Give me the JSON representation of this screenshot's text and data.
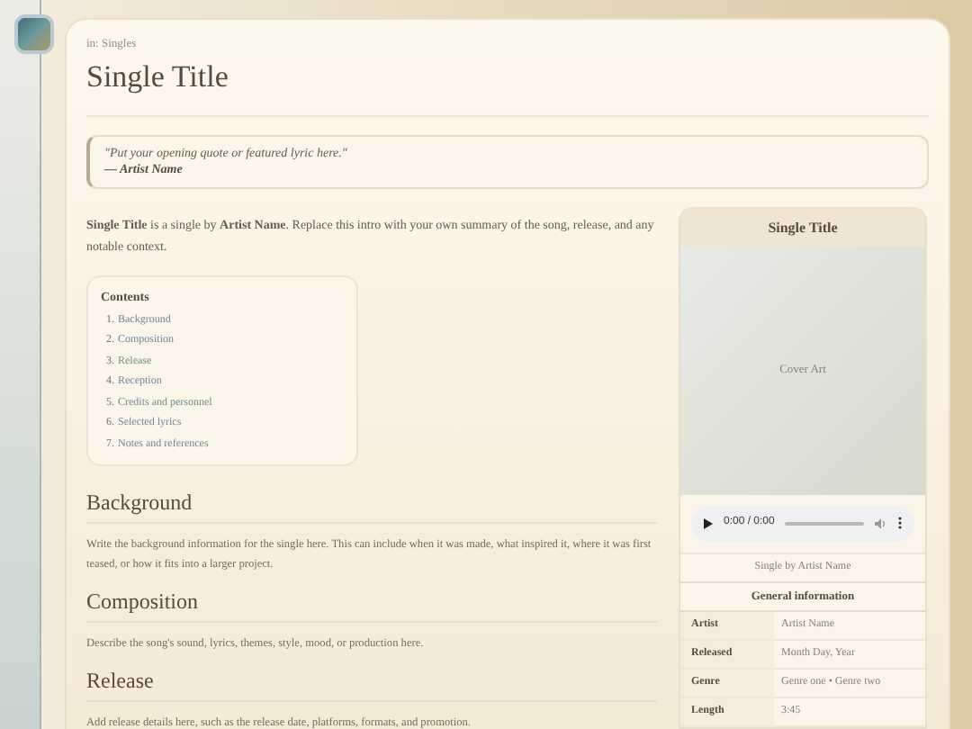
{
  "breadcrumb": "in: Singles",
  "title": "Single Title",
  "quote": {
    "text": "\"Put your opening quote or featured lyric here.\"",
    "attribution": "— Artist Name"
  },
  "intro": "**Single Title** is a single by **Artist Name**. Replace this intro with your own summary of the song, release, and any notable context.",
  "contents": {
    "heading": "Contents",
    "items": [
      {
        "number": "1.",
        "label": "Background"
      },
      {
        "number": "2.",
        "label": "Composition"
      },
      {
        "number": "3.",
        "label": "Release"
      },
      {
        "number": "4.",
        "label": "Reception"
      },
      {
        "number": "5.",
        "label": "Credits and personnel"
      },
      {
        "number": "6.",
        "label": "Selected lyrics"
      },
      {
        "number": "7.",
        "label": "Notes and references"
      }
    ]
  },
  "sections": [
    {
      "heading": "Background",
      "body": "Write the background information for the single here. This can include when it was made, what inspired it, where it was first teased, or how it fits into a larger project."
    },
    {
      "heading": "Composition",
      "body": "Describe the song's sound, lyrics, themes, style, mood, or production here."
    },
    {
      "heading": "Release",
      "body": "Add release details here, such as the release date, platforms, formats, and promotion."
    }
  ],
  "infobox": {
    "title": "Single Title",
    "cover_label": "Cover Art",
    "audio_time": "0:00 / 0:00",
    "caption": "Single by Artist Name",
    "section_heading": "General information",
    "rows": [
      {
        "label": "Artist",
        "value": "Artist Name"
      },
      {
        "label": "Released",
        "value": "Month Day, Year"
      },
      {
        "label": "Genre",
        "value": "Genre one • Genre two"
      },
      {
        "label": "Length",
        "value": "3:45"
      }
    ]
  }
}
